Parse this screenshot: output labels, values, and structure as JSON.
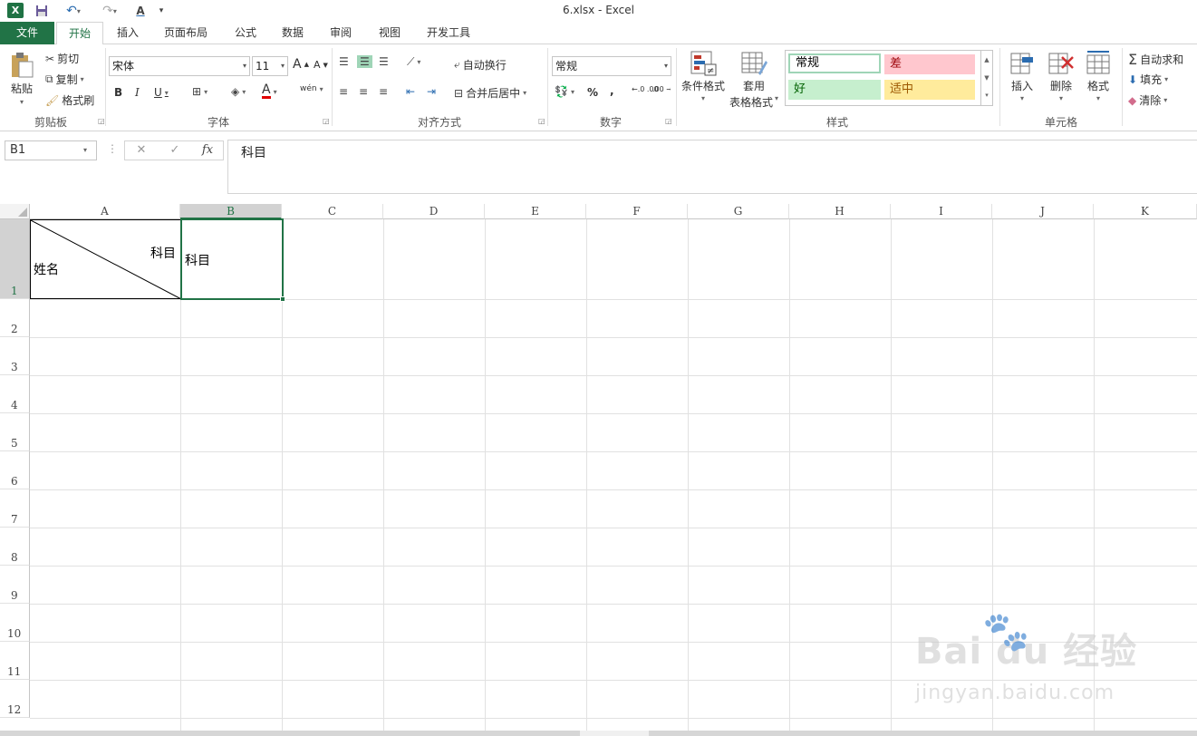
{
  "window": {
    "title": "6.xlsx - Excel",
    "app_logo": "X",
    "icons": {
      "save": "save-icon",
      "undo": "undo-icon",
      "redo": "redo-icon",
      "font_color": "font-color-icon"
    }
  },
  "tabs": [
    {
      "label": "文件"
    },
    {
      "label": "开始"
    },
    {
      "label": "插入"
    },
    {
      "label": "页面布局"
    },
    {
      "label": "公式"
    },
    {
      "label": "数据"
    },
    {
      "label": "审阅"
    },
    {
      "label": "视图"
    },
    {
      "label": "开发工具"
    }
  ],
  "ribbon": {
    "clipboard": {
      "group_label": "剪贴板",
      "paste": "粘贴",
      "cut": "剪切",
      "copy": "复制",
      "format_painter": "格式刷"
    },
    "font": {
      "group_label": "字体",
      "font_name": "宋体",
      "font_size": "11",
      "bold": "B",
      "italic": "I",
      "underline": "U",
      "grow": "A",
      "shrink": "A",
      "font_color_letter": "A",
      "phonetic": "wén",
      "font_color_hex": "#e00000"
    },
    "alignment": {
      "group_label": "对齐方式",
      "wrap_text": "自动换行",
      "merge_center": "合并后居中"
    },
    "number": {
      "group_label": "数字",
      "format": "常规",
      "percent": "%",
      "comma": ",",
      "inc_decimal": "←.0 .00",
      "dec_decimal": ".00 →.0"
    },
    "styles": {
      "group_label": "样式",
      "conditional_format": "条件格式",
      "table_format_line1": "套用",
      "table_format_line2": "表格格式",
      "normal": "常规",
      "bad": "差",
      "good": "好",
      "neutral": "适中"
    },
    "cells": {
      "group_label": "单元格",
      "insert": "插入",
      "delete": "删除",
      "format": "格式"
    },
    "editing": {
      "autosum": "自动求和",
      "fill": "填充",
      "clear": "清除"
    }
  },
  "formula_bar": {
    "name_box": "B1",
    "cancel": "✕",
    "enter": "✓",
    "fx": "fx",
    "content": "科目"
  },
  "sheet": {
    "columns": [
      "A",
      "B",
      "C",
      "D",
      "E",
      "F",
      "G",
      "H",
      "I",
      "J",
      "K"
    ],
    "rows": [
      "1",
      "2",
      "3",
      "4",
      "5",
      "6",
      "7",
      "8",
      "9",
      "10",
      "11",
      "12"
    ],
    "active_cell": "B1",
    "accent_color": "#217346",
    "cells": {
      "A1_top": "科目",
      "A1_bottom": "姓名",
      "B1": "科目"
    }
  },
  "watermark": {
    "logo": "Bai du 经验",
    "url": "jingyan.baidu.com"
  }
}
